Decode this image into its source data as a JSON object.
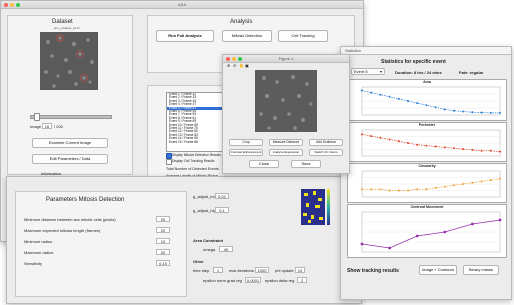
{
  "colors": {
    "accent": "#2f6fd6",
    "marker_blue": "#2a7fd8",
    "marker_red": "#e0442a",
    "marker_orange": "#f0a030",
    "marker_purple": "#9b2fb0"
  },
  "main_window": {
    "title": "ASA",
    "dataset": {
      "heading": "Dataset",
      "filename": "jerry_dataset_p1.tif",
      "image_label": "Image",
      "image_value": "16",
      "image_total": "/ 200",
      "examine_btn": "Examine Current Image",
      "edit_btn": "Edit Parameters / Data"
    },
    "analysis": {
      "heading": "Analysis",
      "run_btn": "Run Full Analysis",
      "mitosis_btn": "Mitosis Detection",
      "cell_btn": "Cell Tracking"
    },
    "events": {
      "items": [
        "Event 1 / Frame 32",
        "Event 2 / Frame 33",
        "Event 3 / Frame 45",
        "Event 4 / Frame 47",
        "Event 5 / Frame 53",
        "Event 6 / Frame 55",
        "Event 7 / Frame 59",
        "Event 8 / Frame 61",
        "Event 9 / Frame 65",
        "Event 10 / Frame 69",
        "Event 11 / Frame 75",
        "Event 12 / Frame 80",
        "Event 13 / Frame 83",
        "Event 14 / Frame 85",
        "Event 15 / Frame 86"
      ],
      "check1": "Display Mitosis Detection Results",
      "check2": "Display Cell Tracking Results",
      "total_label": "Total Number of Detected Events",
      "avg_label": "Average Length of Mitotic Phase"
    },
    "info_label": "Information"
  },
  "params_window": {
    "heading": "Parameters Mitosis Detection",
    "rows": [
      {
        "label": "Minimum distance between two mitotic cells (pixels)",
        "value": "20"
      },
      {
        "label": "Maximum expected mitosis length (frames)",
        "value": "20"
      },
      {
        "label": "Minimum radius",
        "value": "10"
      },
      {
        "label": "Maximum radius",
        "value": "20"
      },
      {
        "label": "Sensitivity",
        "value": "0.15"
      }
    ],
    "g_adjust_low_label": "g_adjust_low",
    "g_adjust_low": "0.02",
    "g_adjust_high_label": "g_adjust_high",
    "g_adjust_high": "0.1",
    "area_label": "Area Constraint",
    "omega_label": "omega",
    "omega": "40",
    "other_label": "Other",
    "time_step_label": "time step",
    "time_step": "1",
    "max_iter_label": "max iterations",
    "max_iter": "1000",
    "phi_update_label": "phi update",
    "phi_update": "10",
    "eps_norm_label": "epsilon norm grad reg",
    "eps_norm": "0.0001",
    "eps_delta_label": "epsilon delta reg",
    "eps_delta": "2"
  },
  "popup_window": {
    "title": "Figure 1",
    "buttons": [
      "Crop",
      "Measure Distance",
      "Add Scalebar",
      "Contrast Enhancement",
      "Analyze Expression",
      "Switch Ch Colors",
      "Close",
      "Save"
    ]
  },
  "stats_window": {
    "title": "Statistics",
    "heading": "Statistics for specific event",
    "event_select": "Event 5",
    "duration": "Duration: 8 hrs / 24 mins",
    "fate": "Fate: regular",
    "plots": [
      "Area",
      "Perimeter",
      "Circularity",
      "Centroid Movement"
    ],
    "show_label": "Show tracking results",
    "image_contours_btn": "Image + Contours",
    "binary_masks_btn": "Binary masks"
  },
  "chart_data": [
    {
      "type": "line",
      "title": "Area",
      "x": [
        0,
        1,
        2,
        3,
        4,
        5,
        6,
        7,
        8,
        9,
        10,
        11,
        12,
        13,
        14,
        15
      ],
      "series": [
        {
          "values": [
            1350,
            1320,
            1290,
            1260,
            1230,
            1200,
            1170,
            1140,
            1110,
            1080,
            1060,
            1050,
            1040,
            1035,
            1030,
            1030
          ]
        }
      ],
      "ylim": [
        1000,
        1400
      ]
    },
    {
      "type": "line",
      "title": "Perimeter",
      "x": [
        0,
        1,
        2,
        3,
        4,
        5,
        6,
        7,
        8,
        9,
        10,
        11,
        12,
        13,
        14,
        15
      ],
      "series": [
        {
          "values": [
            140,
            138,
            136,
            134,
            132,
            130,
            128,
            127,
            126,
            125,
            124,
            123,
            122,
            121,
            121,
            120
          ]
        }
      ],
      "ylim": [
        115,
        145
      ]
    },
    {
      "type": "line",
      "title": "Circularity",
      "x": [
        0,
        1,
        2,
        3,
        4,
        5,
        6,
        7,
        8,
        9,
        10,
        11,
        12,
        13,
        14,
        15
      ],
      "series": [
        {
          "values": [
            0.86,
            0.86,
            0.86,
            0.85,
            0.85,
            0.85,
            0.86,
            0.86,
            0.87,
            0.88,
            0.89,
            0.9,
            0.91,
            0.92,
            0.93,
            0.94
          ]
        }
      ],
      "ylim": [
        0.8,
        1.0
      ]
    },
    {
      "type": "line",
      "title": "Centroid Movement",
      "x": [
        246,
        248,
        250,
        252,
        254,
        256
      ],
      "series": [
        {
          "values": [
            2,
            1,
            4,
            5,
            7,
            8
          ]
        }
      ],
      "ylim": [
        0,
        10
      ]
    }
  ]
}
